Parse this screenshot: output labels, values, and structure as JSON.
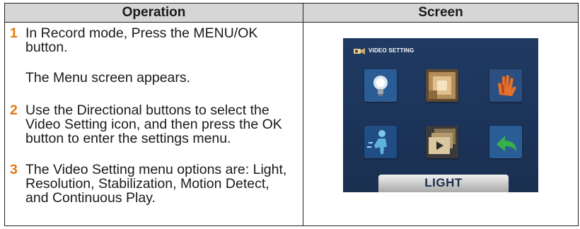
{
  "table": {
    "headers": {
      "operation": "Operation",
      "screen": "Screen"
    },
    "steps": [
      {
        "number": "1",
        "text": "In Record mode, Press the MENU/OK button.",
        "note": "The Menu screen appears."
      },
      {
        "number": "2",
        "text": "Use the Directional buttons to select the Video Setting icon, and then press the OK button to enter the settings menu."
      },
      {
        "number": "3",
        "text": "The Video Setting menu options are: Light, Resolution, Stabilization, Motion Detect, and Continuous Play."
      }
    ]
  },
  "camera_screen": {
    "title": "VIDEO SETTING",
    "highlight_label": "LIGHT",
    "icons": [
      "light-bulb-icon",
      "resolution-icon",
      "stabilization-hand-icon",
      "motion-detect-icon",
      "continuous-play-icon",
      "return-icon"
    ],
    "colors": {
      "background": "#1e375d",
      "step_number": "#e07a10",
      "header_bg": "#d6d6d6"
    }
  }
}
